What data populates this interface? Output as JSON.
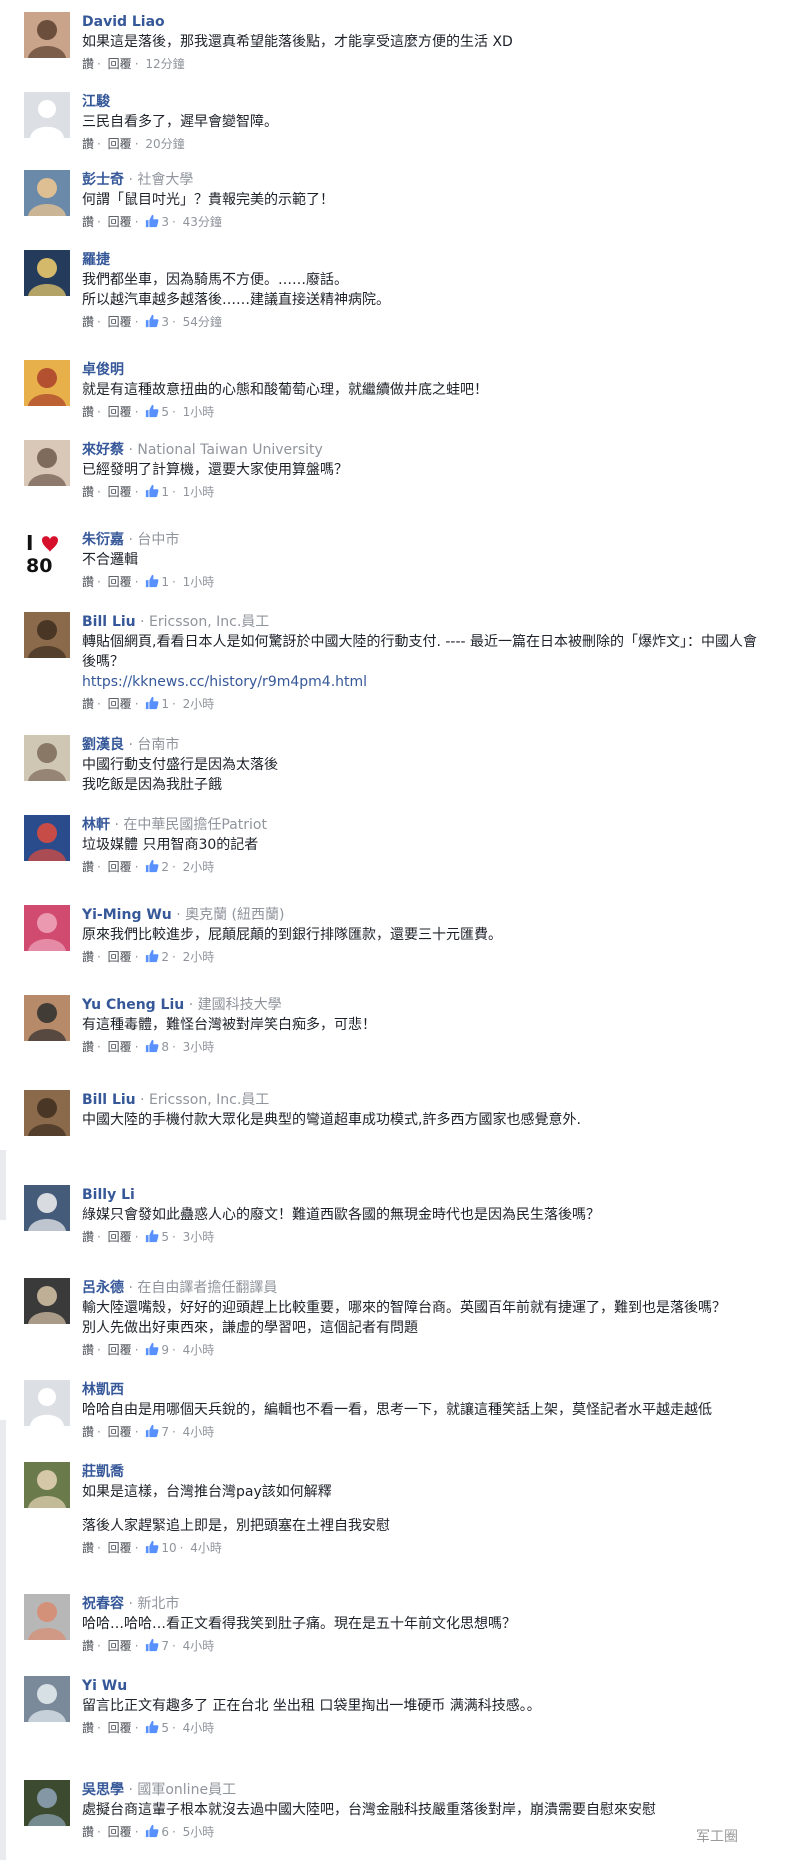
{
  "comments": [
    {
      "name": "David Liao",
      "affil": "",
      "lines": [
        "如果這是落後，那我還真希望能落後點，才能享受這麼方便的生活 XD"
      ],
      "actions": {
        "like": "讚",
        "reply": "回覆",
        "likes": "",
        "time": "12分鐘"
      }
    },
    {
      "name": "江駿",
      "affil": "",
      "lines": [
        "三民自看多了，遲早會變智障。"
      ],
      "actions": {
        "like": "讚",
        "reply": "回覆",
        "likes": "",
        "time": "20分鐘"
      }
    },
    {
      "name": "彭士奇",
      "affil": "社會大學",
      "lines": [
        "何謂「鼠目吋光」？貴報完美的示範了！"
      ],
      "actions": {
        "like": "讚",
        "reply": "回覆",
        "likes": "3",
        "time": "43分鐘"
      }
    },
    {
      "name": "羅捷",
      "affil": "",
      "lines": [
        "我們都坐車，因為騎馬不方便。……廢話。",
        "所以越汽車越多越落後……建議直接送精神病院。"
      ],
      "actions": {
        "like": "讚",
        "reply": "回覆",
        "likes": "3",
        "time": "54分鐘"
      }
    },
    {
      "name": "卓俊明",
      "affil": "",
      "lines": [
        "就是有這種故意扭曲的心態和酸葡萄心理，就繼續做井底之蛙吧！"
      ],
      "actions": {
        "like": "讚",
        "reply": "回覆",
        "likes": "5",
        "time": "1小時"
      }
    },
    {
      "name": "來好蔡",
      "affil": "National Taiwan University",
      "lines": [
        "已經發明了計算機，還要大家使用算盤嗎？"
      ],
      "actions": {
        "like": "讚",
        "reply": "回覆",
        "likes": "1",
        "time": "1小時"
      }
    },
    {
      "name": "朱衍嘉",
      "affil": "台中市",
      "lines": [
        "不合邏輯"
      ],
      "actions": {
        "like": "讚",
        "reply": "回覆",
        "likes": "1",
        "time": "1小時"
      }
    },
    {
      "name": "Bill Liu",
      "affil": "Ericsson, Inc.員工",
      "lines": [
        "轉貼個網頁,看看日本人是如何驚訝於中國大陸的行動支付. ---- 最近一篇在日本被刪除的「爆炸文」：中國人會",
        "後嗎？"
      ],
      "link": "https://kknews.cc/history/r9m4pm4.html",
      "actions": {
        "like": "讚",
        "reply": "回覆",
        "likes": "1",
        "time": "2小時"
      }
    },
    {
      "name": "劉漢良",
      "affil": "台南市",
      "lines": [
        "中國行動支付盛行是因為太落後",
        "我吃飯是因為我肚子餓"
      ],
      "actions": {
        "like": "",
        "reply": "",
        "likes": "",
        "time": ""
      }
    },
    {
      "name": "林軒",
      "affil": "在中華民國擔任Patriot",
      "lines": [
        "垃圾媒體 只用智商30的記者"
      ],
      "actions": {
        "like": "讚",
        "reply": "回覆",
        "likes": "2",
        "time": "2小時"
      }
    },
    {
      "name": "Yi-Ming Wu",
      "affil": "奧克蘭 (紐西蘭)",
      "lines": [
        "原來我們比較進步，屁顛屁顛的到銀行排隊匯款，還要三十元匯費。"
      ],
      "actions": {
        "like": "讚",
        "reply": "回覆",
        "likes": "2",
        "time": "2小時"
      }
    },
    {
      "name": "Yu Cheng Liu",
      "affil": "建國科技大學",
      "lines": [
        "有這種毒體，難怪台灣被對岸笑白痴多，可悲！"
      ],
      "actions": {
        "like": "讚",
        "reply": "回覆",
        "likes": "8",
        "time": "3小時"
      }
    },
    {
      "name": "Bill Liu",
      "affil": "Ericsson, Inc.員工",
      "lines": [
        "中國大陸的手機付款大眾化是典型的彎道超車成功模式,許多西方國家也感覺意外."
      ],
      "actions": {
        "like": "",
        "reply": "",
        "likes": "",
        "time": ""
      }
    },
    {
      "name": "Billy Li",
      "affil": "",
      "lines": [
        "綠媒只會發如此蠱惑人心的廢文！難道西歐各國的無現金時代也是因為民生落後嗎？"
      ],
      "actions": {
        "like": "讚",
        "reply": "回覆",
        "likes": "5",
        "time": "3小時"
      }
    },
    {
      "name": "呂永德",
      "affil": "在自由譯者擔任翻譯員",
      "lines": [
        "輸大陸還嘴殼，好好的迎頭趕上比較重要，哪來的智障台商。英國百年前就有捷運了，難到也是落後嗎？",
        "別人先做出好東西來，謙虛的學習吧，這個記者有問題"
      ],
      "actions": {
        "like": "讚",
        "reply": "回覆",
        "likes": "9",
        "time": "4小時"
      }
    },
    {
      "name": "林凱西",
      "affil": "",
      "lines": [
        "哈哈自由是用哪個天兵銳的，編輯也不看一看，思考一下，就讓這種笑話上架，莫怪記者水平越走越低"
      ],
      "actions": {
        "like": "讚",
        "reply": "回覆",
        "likes": "7",
        "time": "4小時"
      }
    },
    {
      "name": "莊凱喬",
      "affil": "",
      "lines": [
        "如果是這樣，台灣推台灣pay該如何解釋",
        "",
        "落後人家趕緊追上即是，別把頭塞在土裡自我安慰"
      ],
      "actions": {
        "like": "讚",
        "reply": "回覆",
        "likes": "10",
        "time": "4小時"
      }
    },
    {
      "name": "祝春容",
      "affil": "新北市",
      "lines": [
        "哈哈…哈哈…看正文看得我笑到肚子痛。現在是五十年前文化思想嗎？"
      ],
      "actions": {
        "like": "讚",
        "reply": "回覆",
        "likes": "7",
        "time": "4小時"
      }
    },
    {
      "name": "Yi Wu",
      "affil": "",
      "lines": [
        "留言比正文有趣多了 正在台北 坐出租 口袋里掏出一堆硬币 满满科技感。。"
      ],
      "actions": {
        "like": "讚",
        "reply": "回覆",
        "likes": "5",
        "time": "4小時"
      }
    },
    {
      "name": "吳思學",
      "affil": "國軍online員工",
      "lines": [
        "處擬台商這輩子根本就沒去過中國大陸吧，台灣金融科技嚴重落後對岸，崩潰需要自慰來安慰"
      ],
      "actions": {
        "like": "讚",
        "reply": "回覆",
        "likes": "6",
        "time": "5小時"
      }
    }
  ],
  "watermark": "军工圈",
  "colors": {
    "name": "#365899",
    "meta": "#90949c",
    "text": "#1d2129",
    "like": "#5890ff"
  }
}
